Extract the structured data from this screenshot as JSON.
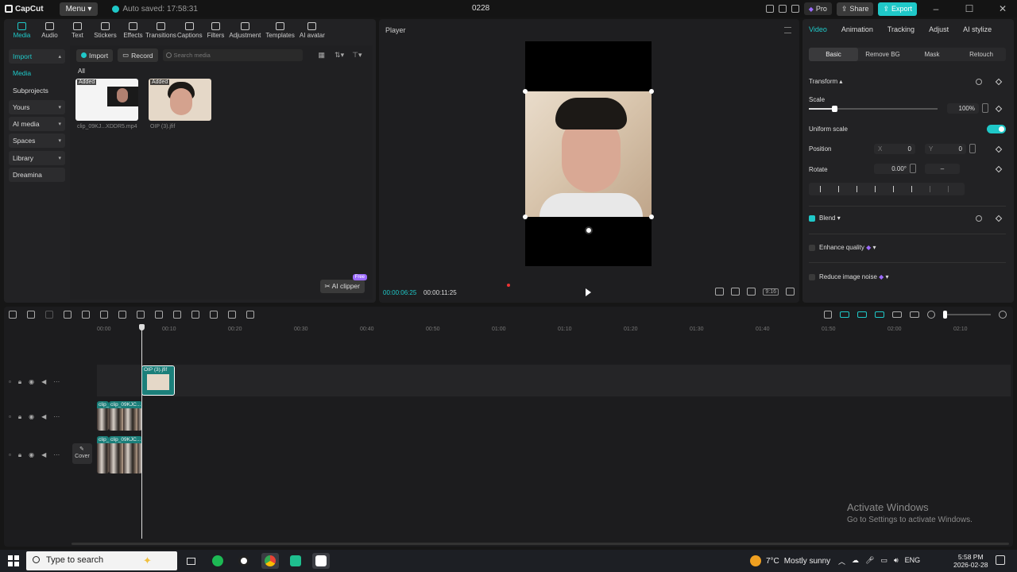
{
  "titlebar": {
    "app_name": "CapCut",
    "menu_label": "Menu",
    "autosave": "Auto saved: 17:58:31",
    "project_name": "0228",
    "pro_label": "Pro",
    "share_label": "Share",
    "export_label": "Export"
  },
  "toolbar": {
    "categories": [
      "Media",
      "Audio",
      "Text",
      "Stickers",
      "Effects",
      "Transitions",
      "Captions",
      "Filters",
      "Adjustment",
      "Templates",
      "AI avatar"
    ]
  },
  "sidebar": {
    "items": [
      "Import",
      "Media",
      "Subprojects",
      "Yours",
      "AI media",
      "Spaces",
      "Library",
      "Dreamina"
    ]
  },
  "media": {
    "import_label": "Import",
    "record_label": "Record",
    "search_placeholder": "Search media",
    "filter_label": "All",
    "added_badge": "Added",
    "items": [
      {
        "name": "clip_09KJ...XDDR5.mp4"
      },
      {
        "name": "OIP (3).jfif"
      }
    ],
    "ai_clipper_label": "AI clipper",
    "free_badge": "Free"
  },
  "player": {
    "title": "Player",
    "current_time": "00:00:06:25",
    "total_time": "00:00:11:25",
    "ratio_label": "9:16"
  },
  "properties": {
    "tabs": [
      "Video",
      "Animation",
      "Tracking",
      "Adjust",
      "AI stylize"
    ],
    "subtabs": [
      "Basic",
      "Remove BG",
      "Mask",
      "Retouch"
    ],
    "transform_label": "Transform",
    "scale_label": "Scale",
    "scale_value": "100%",
    "scale_fraction": 0.2,
    "uniform_scale_label": "Uniform scale",
    "position_label": "Position",
    "x_label": "X",
    "x_value": "0",
    "y_label": "Y",
    "y_value": "0",
    "rotate_label": "Rotate",
    "rotate_value": "0.00°",
    "rotate_extra": "–",
    "blend_label": "Blend",
    "enhance_label": "Enhance quality",
    "noise_label": "Reduce image noise"
  },
  "timeline": {
    "ruler": [
      "00:00",
      "00:10",
      "00:20",
      "00:30",
      "00:40",
      "00:50",
      "01:00",
      "01:10",
      "01:20",
      "01:30",
      "01:40",
      "01:50",
      "02:00",
      "02:10"
    ],
    "image_clip_label": "OIP (3).jfif",
    "video_clip_a": "clip_",
    "video_clip_b": "clip_09KJC...",
    "cover_label": "Cover"
  },
  "watermark": {
    "line1": "Activate Windows",
    "line2": "Go to Settings to activate Windows."
  },
  "taskbar": {
    "search_placeholder": "Type to search",
    "weather_temp": "7°C",
    "weather_text": "Mostly sunny",
    "lang": "ENG",
    "time": "5:58 PM",
    "date": "2026-02-28"
  },
  "colors": {
    "accent": "#1fc8c8",
    "pro_purple": "#9c6bff"
  }
}
